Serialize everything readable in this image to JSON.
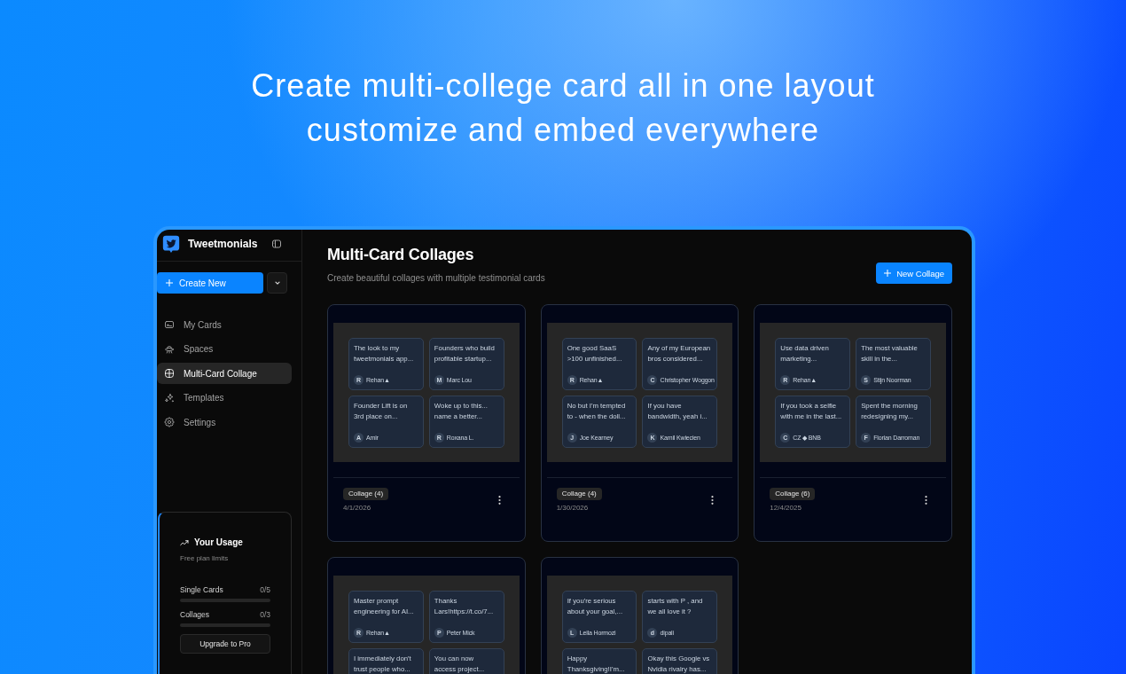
{
  "headline": {
    "lines": [
      "Create multi-college card all in one layout",
      "customize and embed everywhere"
    ]
  },
  "sidebar": {
    "brand": "Tweetmonials",
    "create_button": "Create New",
    "nav_items": [
      {
        "label": "My Cards",
        "selected": false
      },
      {
        "label": "Spaces",
        "selected": false
      },
      {
        "label": "Multi-Card Collage",
        "selected": true
      },
      {
        "label": "Templates",
        "selected": false
      },
      {
        "label": "Settings",
        "selected": false
      }
    ],
    "usage": {
      "title": "Your Usage",
      "subtitle": "Free plan limits",
      "meters": [
        {
          "label": "Single Cards",
          "reading": "0/5",
          "level": 0
        },
        {
          "label": "Collages",
          "reading": "0/3",
          "level": 0
        }
      ],
      "button": "Upgrade to Pro"
    }
  },
  "main": {
    "title": "Multi-Card Collages",
    "subtitle": "Create beautiful collages with multiple testimonial cards",
    "new_button": "New Collage",
    "collages": [
      {
        "tag": "Collage (4)",
        "date": "4/1/2026",
        "cards": [
          {
            "text": "The look to my\ntweetmonials app...",
            "initial": "R",
            "author": "Rehan▲"
          },
          {
            "text": "Founders who build\nprofitable startup...",
            "initial": "M",
            "author": "Marc Lou"
          },
          {
            "text": "Founder Lift is on\n3rd place on...",
            "initial": "A",
            "author": "Amir"
          },
          {
            "text": "Woke up to this...\nname a better...",
            "initial": "R",
            "author": "Roxana L."
          }
        ]
      },
      {
        "tag": "Collage (4)",
        "date": "1/30/2026",
        "cards": [
          {
            "text": "One good SaaS\n>100 unfinished...",
            "initial": "R",
            "author": "Rehan▲"
          },
          {
            "text": "Any of my European\nbros considered...",
            "initial": "C",
            "author": "Christopher Woggon"
          },
          {
            "text": "No but I'm tempted\nto - when the doll...",
            "initial": "J",
            "author": "Joe Kearney"
          },
          {
            "text": "If you have\nbandwidth, yeah i...",
            "initial": "K",
            "author": "Kamil Kwiecien"
          }
        ]
      },
      {
        "tag": "Collage (6)",
        "date": "12/4/2025",
        "cards": [
          {
            "text": "Use data driven\nmarketing...",
            "initial": "R",
            "author": "Rehan▲"
          },
          {
            "text": "The most valuable\nskill in the...",
            "initial": "S",
            "author": "Stijn Noorman"
          },
          {
            "text": "If you took a selfie\nwith me in the last...",
            "initial": "C",
            "author": "CZ ◆ BNB"
          },
          {
            "text": "Spent the morning\nredesigning my...",
            "initial": "F",
            "author": "Florian Darroman"
          }
        ]
      },
      {
        "cards": [
          {
            "text": "Master prompt\nengineering for AI...",
            "initial": "R",
            "author": "Rehan▲"
          },
          {
            "text": "Thanks\nLars!https://t.co/7...",
            "initial": "P",
            "author": "Peter Mick"
          },
          {
            "text": "I immediately don't\ntrust people who..."
          },
          {
            "text": "You can now\naccess project..."
          }
        ]
      },
      {
        "cards": [
          {
            "text": "If you're serious\nabout your goal,...",
            "initial": "L",
            "author": "Leila Hormozi"
          },
          {
            "text": "starts with P , and\nwe all love it ?",
            "initial": "d",
            "author": "dipali"
          },
          {
            "text": "Happy\nThanksgiving!I'm..."
          },
          {
            "text": "Okay this Google vs\nNvidia rivalry has..."
          }
        ]
      }
    ]
  }
}
